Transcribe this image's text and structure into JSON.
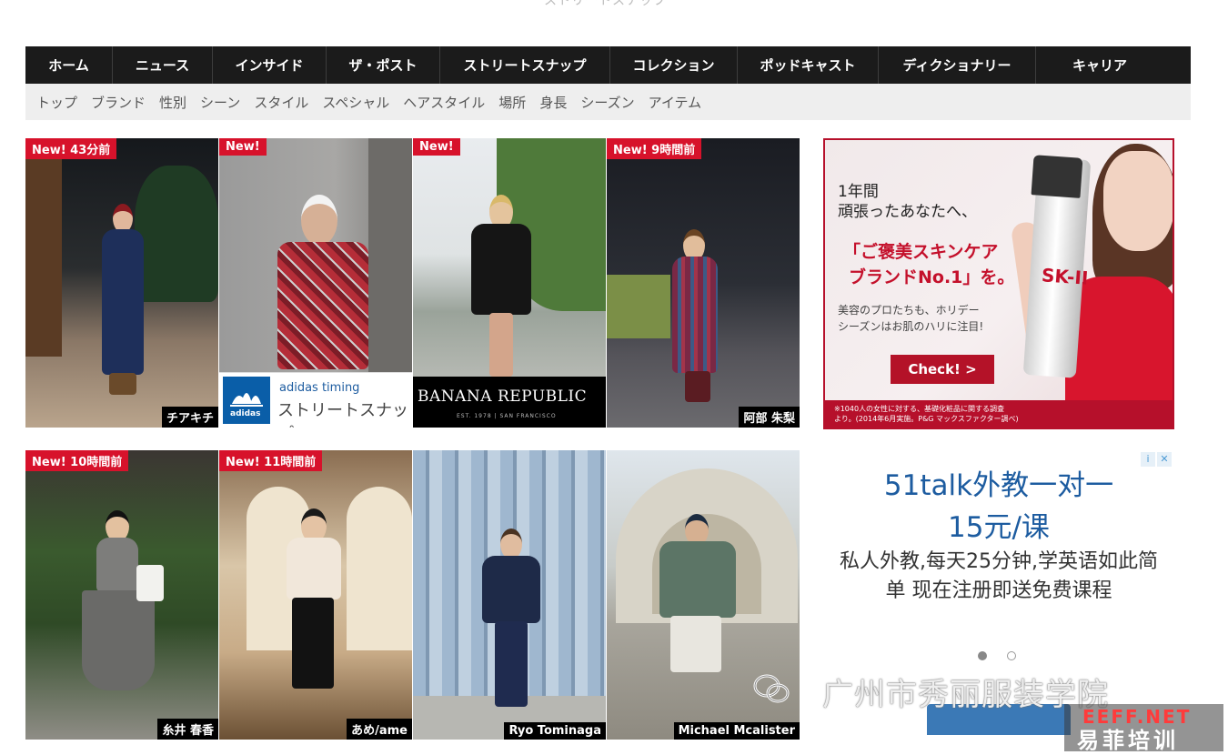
{
  "page_caption": "ストリートスナップ",
  "main_nav": [
    "ホーム",
    "ニュース",
    "インサイド",
    "ザ・ポスト",
    "ストリートスナップ",
    "コレクション",
    "ポッドキャスト",
    "ディクショナリー",
    "キャリア"
  ],
  "sub_nav": [
    "トップ",
    "ブランド",
    "性別",
    "シーン",
    "スタイル",
    "スペシャル",
    "ヘアスタイル",
    "場所",
    "身長",
    "シーズン",
    "アイテム"
  ],
  "tiles": [
    {
      "badge": "New! 43分前",
      "name": "チアキチ"
    },
    {
      "badge": "New!",
      "name": ""
    },
    {
      "badge": "New!",
      "name": ""
    },
    {
      "badge": "New! 9時間前",
      "name": "阿部 朱梨"
    },
    {
      "badge": "New! 10時間前",
      "name": "糸井 春香"
    },
    {
      "badge": "New! 11時間前",
      "name": "あめ/ame"
    },
    {
      "badge": "",
      "name": "Ryo Tominaga"
    },
    {
      "badge": "",
      "name": "Michael Mcalister"
    }
  ],
  "adidas_ad": {
    "line1": "adidas timing",
    "line2": "ストリートスナップ",
    "logo_text": "adidas"
  },
  "banana_ad": {
    "brand": "BANANA REPUBLIC",
    "tagline": "EST. 1978 | SAN FRANCISCO"
  },
  "skii_ad": {
    "line1": "1年間",
    "line2": "頑張ったあなたへ、",
    "headline1": "「ご褒美スキンケア",
    "headline2": "ブランドNo.1」を。",
    "body1": "美容のプロたちも、ホリデー",
    "body2": "シーズンはお肌のハリに注目!",
    "button": "Check! >",
    "footnote1": "※1040人の女性に対する、基礎化粧品に関する調査",
    "footnote2": "より。(2014年6月実施。P&G マックスファクター調べ)",
    "bottle_label": "SK-II"
  },
  "talk_ad": {
    "headline1": "51talk外教一对一",
    "headline2": "15元/课",
    "body": "私人外教,每天25分钟,学英语如此简单 现在注册即送免费课程",
    "info_icon": "i",
    "close_icon": "✕"
  },
  "watermark": {
    "text": "广州市秀丽服装学院",
    "site": "EEFF.NET",
    "site_cn": "易菲培训"
  },
  "colors": {
    "nav_bg": "#1b1b1b",
    "subnav_bg": "#eeeeee",
    "badge_red": "#d7122b",
    "skii_red": "#b6102b",
    "talk_blue": "#1d5ca0"
  }
}
